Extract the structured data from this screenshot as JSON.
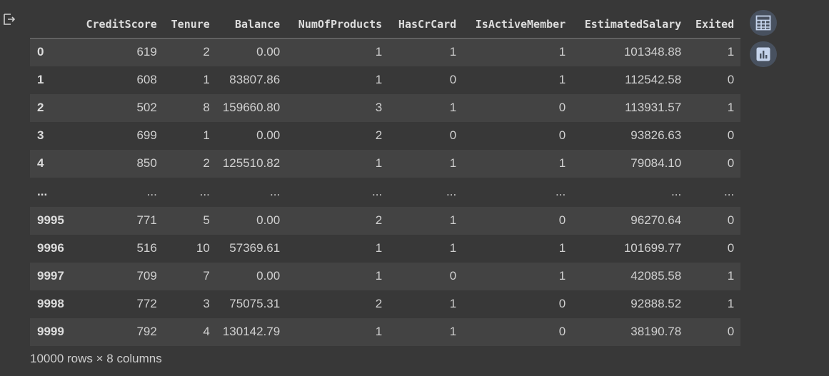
{
  "icons": {
    "output": "output-redirect-icon",
    "table_button": "table-grid-icon",
    "chart_button": "bar-chart-icon"
  },
  "dataframe": {
    "columns": [
      "CreditScore",
      "Tenure",
      "Balance",
      "NumOfProducts",
      "HasCrCard",
      "IsActiveMember",
      "EstimatedSalary",
      "Exited"
    ],
    "rows": [
      {
        "index": "0",
        "cells": [
          "619",
          "2",
          "0.00",
          "1",
          "1",
          "1",
          "101348.88",
          "1"
        ]
      },
      {
        "index": "1",
        "cells": [
          "608",
          "1",
          "83807.86",
          "1",
          "0",
          "1",
          "112542.58",
          "0"
        ]
      },
      {
        "index": "2",
        "cells": [
          "502",
          "8",
          "159660.80",
          "3",
          "1",
          "0",
          "113931.57",
          "1"
        ]
      },
      {
        "index": "3",
        "cells": [
          "699",
          "1",
          "0.00",
          "2",
          "0",
          "0",
          "93826.63",
          "0"
        ]
      },
      {
        "index": "4",
        "cells": [
          "850",
          "2",
          "125510.82",
          "1",
          "1",
          "1",
          "79084.10",
          "0"
        ]
      },
      {
        "index": "...",
        "cells": [
          "...",
          "...",
          "...",
          "...",
          "...",
          "...",
          "...",
          "..."
        ]
      },
      {
        "index": "9995",
        "cells": [
          "771",
          "5",
          "0.00",
          "2",
          "1",
          "0",
          "96270.64",
          "0"
        ]
      },
      {
        "index": "9996",
        "cells": [
          "516",
          "10",
          "57369.61",
          "1",
          "1",
          "1",
          "101699.77",
          "0"
        ]
      },
      {
        "index": "9997",
        "cells": [
          "709",
          "7",
          "0.00",
          "1",
          "0",
          "1",
          "42085.58",
          "1"
        ]
      },
      {
        "index": "9998",
        "cells": [
          "772",
          "3",
          "75075.31",
          "2",
          "1",
          "0",
          "92888.52",
          "1"
        ]
      },
      {
        "index": "9999",
        "cells": [
          "792",
          "4",
          "130142.79",
          "1",
          "1",
          "0",
          "38190.78",
          "0"
        ]
      }
    ],
    "footer": "10000 rows × 8 columns"
  },
  "colors": {
    "background": "#383838",
    "row_stripe": "#434343",
    "button_bg": "#48515f",
    "button_icon": "#c5d4ec"
  }
}
